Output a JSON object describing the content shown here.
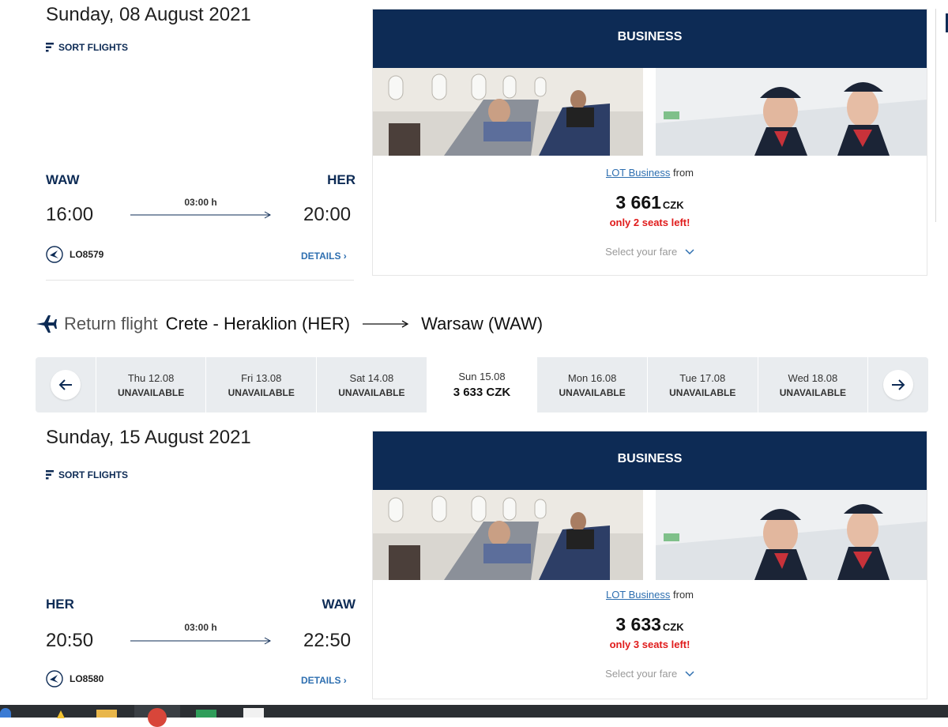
{
  "outbound": {
    "date_title": "Sunday, 08 August 2021",
    "sort_label": "SORT FLIGHTS",
    "from_code": "WAW",
    "to_code": "HER",
    "depart_time": "16:00",
    "arrive_time": "20:00",
    "duration": "03:00 h",
    "flight_number": "LO8579",
    "details_label": "DETAILS ›",
    "card": {
      "header": "BUSINESS",
      "fare_link": "LOT Business",
      "fare_from": " from",
      "price_value": "3 661",
      "price_currency": "CZK",
      "seats_left": "only 2 seats left!",
      "select_fare": "Select your fare"
    }
  },
  "return_header": {
    "label": "Return flight",
    "origin": "Crete - Heraklion (HER)",
    "destination": "Warsaw (WAW)"
  },
  "date_bar": {
    "days": [
      {
        "date": "Thu 12.08",
        "status": "UNAVAILABLE"
      },
      {
        "date": "Fri 13.08",
        "status": "UNAVAILABLE"
      },
      {
        "date": "Sat 14.08",
        "status": "UNAVAILABLE"
      },
      {
        "date": "Sun 15.08",
        "status": "3 633 CZK"
      },
      {
        "date": "Mon 16.08",
        "status": "UNAVAILABLE"
      },
      {
        "date": "Tue 17.08",
        "status": "UNAVAILABLE"
      },
      {
        "date": "Wed 18.08",
        "status": "UNAVAILABLE"
      }
    ],
    "active_index": 3
  },
  "inbound": {
    "date_title": "Sunday, 15 August 2021",
    "sort_label": "SORT FLIGHTS",
    "from_code": "HER",
    "to_code": "WAW",
    "depart_time": "20:50",
    "arrive_time": "22:50",
    "duration": "03:00 h",
    "flight_number": "LO8580",
    "details_label": "DETAILS ›",
    "card": {
      "header": "BUSINESS",
      "fare_link": "LOT Business",
      "fare_from": " from",
      "price_value": "3 633",
      "price_currency": "CZK",
      "seats_left": "only 3 seats left!",
      "select_fare": "Select your fare"
    }
  },
  "colors": {
    "navy": "#0d2b55",
    "link": "#2e6fb0",
    "alert": "#e01b1b",
    "datebar_bg": "#e9ecef",
    "taskbar": "#2b2f33"
  },
  "icons": [
    "sort-icon",
    "lot-crane-logo-icon",
    "arrow-right-icon",
    "plane-return-icon",
    "arrow-left-icon",
    "chevron-down-icon"
  ]
}
